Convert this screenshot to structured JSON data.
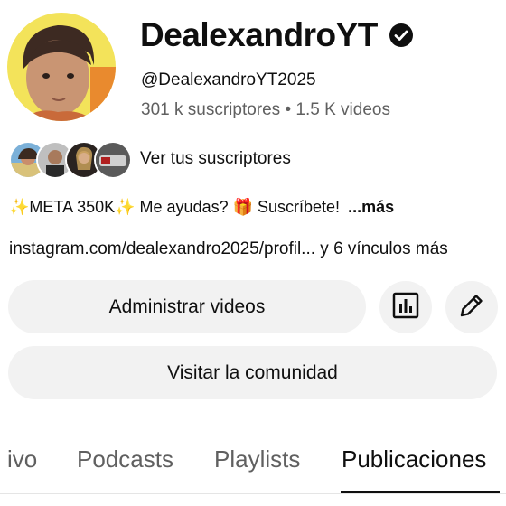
{
  "channel": {
    "name": "DealexandroYT",
    "handle": "@DealexandroYT2025",
    "stats": "301 k suscriptores • 1.5 K videos",
    "verified": true
  },
  "subscribers": {
    "link_label": "Ver tus suscriptores"
  },
  "description": {
    "text": "✨META 350K✨ Me ayudas? 🎁  Suscríbete!",
    "more_label": "...más"
  },
  "links": {
    "text": "instagram.com/dealexandro2025/profil... y 6 vínculos más"
  },
  "actions": {
    "manage_videos_label": "Administrar videos",
    "visit_community_label": "Visitar la comunidad",
    "analytics_icon": "analytics-icon",
    "edit_icon": "pencil-icon"
  },
  "tabs": [
    {
      "label": "ivo",
      "active": false
    },
    {
      "label": "Podcasts",
      "active": false
    },
    {
      "label": "Playlists",
      "active": false
    },
    {
      "label": "Publicaciones",
      "active": true
    }
  ],
  "colors": {
    "text_primary": "#0f0f0f",
    "text_secondary": "#606060",
    "button_bg": "#f2f2f2",
    "avatar_bg": "#f3e35a"
  }
}
